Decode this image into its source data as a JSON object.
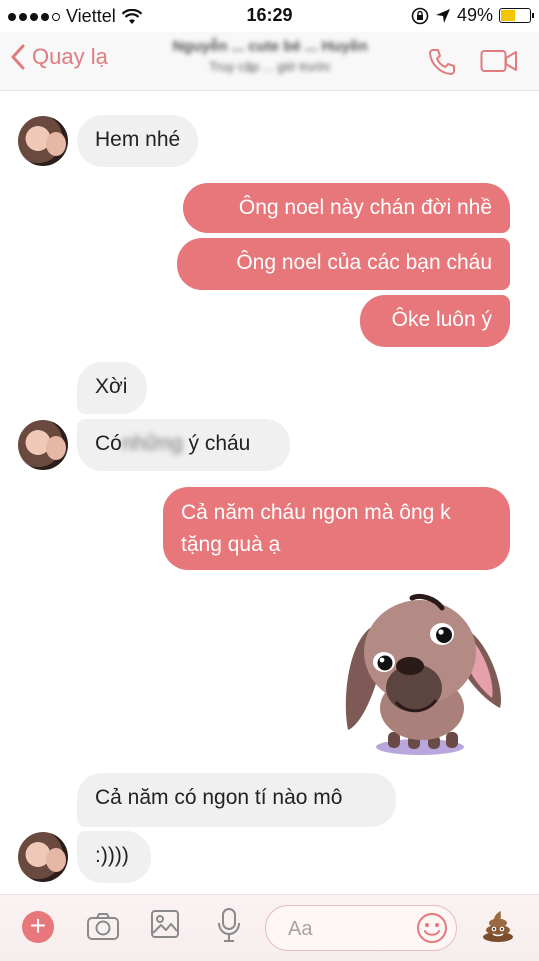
{
  "status_bar": {
    "carrier": "Viettel",
    "time": "16:29",
    "battery": "49%",
    "battery_level": 0.49,
    "icons": [
      "signal-dots",
      "wifi-icon",
      "rotation-lock-icon",
      "location-arrow-icon",
      "battery-icon"
    ]
  },
  "header": {
    "back_label": "Quay lạ",
    "contact_name": "Nguyễn ... cute bé ... Huyền",
    "contact_status": "Truy cập ... giờ trước",
    "icons": [
      "chevron-left-icon",
      "phone-icon",
      "video-camera-icon"
    ]
  },
  "messages": [
    {
      "side": "in",
      "text": "Hem nhé"
    },
    {
      "side": "out",
      "text": "Ông noel này chán đời nhề"
    },
    {
      "side": "out",
      "text": "Ông noel của các bạn cháu"
    },
    {
      "side": "out",
      "text": "Ôke luôn ý"
    },
    {
      "side": "in",
      "text": "Xời"
    },
    {
      "side": "in",
      "text_prefix": "Có",
      "text_blurred": "những",
      "text_suffix": "ý cháu"
    },
    {
      "side": "out",
      "line1": "Cả năm cháu ngon mà ông k",
      "line2": "tặng quà ạ"
    },
    {
      "side": "out",
      "sticker": "dog-sticker"
    },
    {
      "side": "in",
      "text": "Cả năm có ngon tí nào mô"
    },
    {
      "side": "in",
      "text": ":))))"
    }
  ],
  "composer": {
    "placeholder": "Aa",
    "icons": [
      "plus-icon",
      "camera-icon",
      "gallery-icon",
      "microphone-icon",
      "emoji-icon",
      "poo-icon"
    ]
  },
  "colors": {
    "accent": "#e7777a",
    "incoming_bubble": "#f0f0f0",
    "battery_fill": "#f2c500"
  }
}
